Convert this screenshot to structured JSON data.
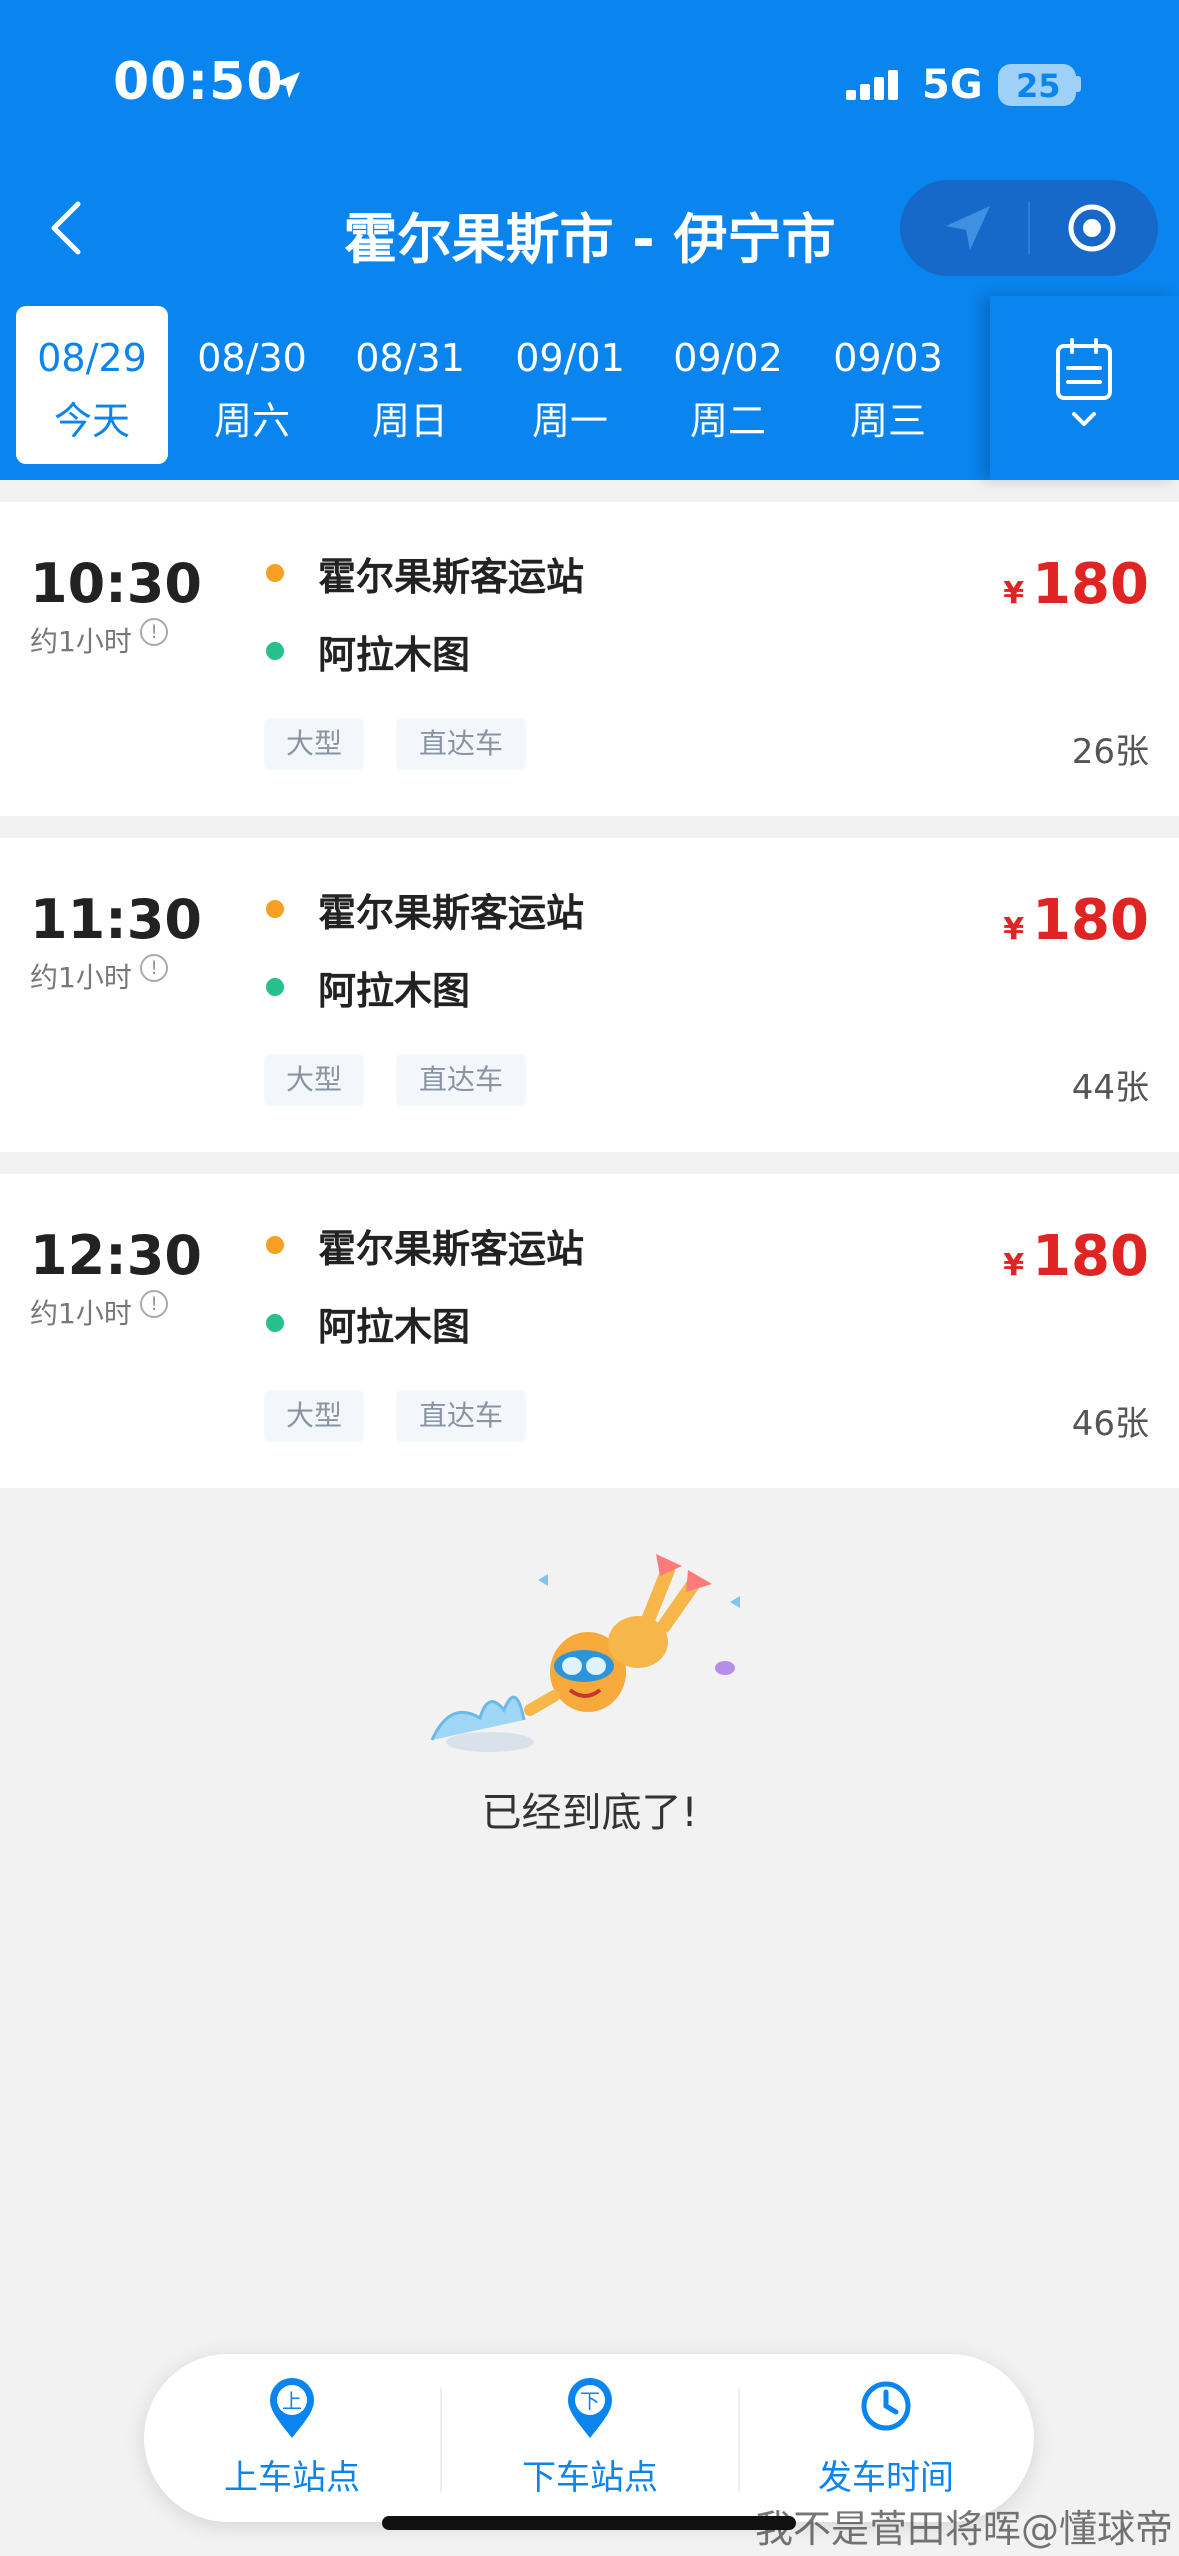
{
  "status_bar": {
    "time": "00:50",
    "network": "5G",
    "battery": "25"
  },
  "nav": {
    "title": "霍尔果斯市 - 伊宁市"
  },
  "dates": [
    {
      "date": "08/29",
      "weekday": "今天",
      "selected": true
    },
    {
      "date": "08/30",
      "weekday": "周六"
    },
    {
      "date": "08/31",
      "weekday": "周日"
    },
    {
      "date": "09/01",
      "weekday": "周一"
    },
    {
      "date": "09/02",
      "weekday": "周二"
    },
    {
      "date": "09/03",
      "weekday": "周三"
    }
  ],
  "trips": [
    {
      "time": "10:30",
      "duration": "约1小时",
      "from": "霍尔果斯客运站",
      "to": "阿拉木图",
      "tags": [
        "大型",
        "直达车"
      ],
      "currency": "¥",
      "price": "180",
      "seats": "26张"
    },
    {
      "time": "11:30",
      "duration": "约1小时",
      "from": "霍尔果斯客运站",
      "to": "阿拉木图",
      "tags": [
        "大型",
        "直达车"
      ],
      "currency": "¥",
      "price": "180",
      "seats": "44张"
    },
    {
      "time": "12:30",
      "duration": "约1小时",
      "from": "霍尔果斯客运站",
      "to": "阿拉木图",
      "tags": [
        "大型",
        "直达车"
      ],
      "currency": "¥",
      "price": "180",
      "seats": "46张"
    }
  ],
  "end_message": "已经到底了!",
  "bottom_bar": {
    "items": [
      {
        "label": "上车站点",
        "icon": "boarding-pin-icon",
        "glyph": "上"
      },
      {
        "label": "下车站点",
        "icon": "alighting-pin-icon",
        "glyph": "下"
      },
      {
        "label": "发车时间",
        "icon": "clock-icon"
      }
    ]
  },
  "watermark": "我不是菅田将晖@懂球帝",
  "colors": {
    "primary": "#0a84ee",
    "price": "#e02323",
    "from_dot": "#f5a023",
    "to_dot": "#27c08a"
  }
}
